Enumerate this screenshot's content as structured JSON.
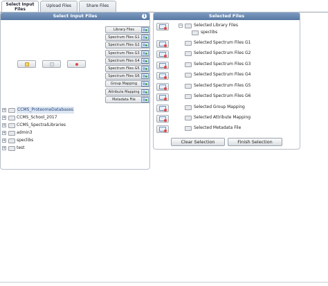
{
  "tabs": [
    {
      "label": "Select Input Files",
      "active": true
    },
    {
      "label": "Upload Files",
      "active": false
    },
    {
      "label": "Share Files",
      "active": false
    }
  ],
  "left_panel": {
    "title": "Select Input Files",
    "info_icon": "i",
    "categories": [
      "Library Files",
      "Spectrum Files G1",
      "Spectrum Files G2",
      "Spectrum Files G3",
      "Spectrum Files G4",
      "Spectrum Files G5",
      "Spectrum Files G6",
      "Group Mapping",
      "Attribute Mapping",
      "Metadata File"
    ],
    "actions": [
      "add-file-icon",
      "edit-icon",
      "delete-icon"
    ],
    "tree": [
      {
        "label": "CCMS_ProteomeDatabases",
        "selected": true
      },
      {
        "label": "CCMS_School_2017",
        "selected": false
      },
      {
        "label": "CCMS_SpectralLibraries",
        "selected": false
      },
      {
        "label": "admin3",
        "selected": false
      },
      {
        "label": "speclibs",
        "selected": false
      },
      {
        "label": "test",
        "selected": false
      }
    ]
  },
  "right_panel": {
    "title": "Selected Files",
    "items": [
      {
        "label": "Selected Library Files",
        "children": [
          "speclibs"
        ]
      },
      {
        "label": "Selected Spectrum Files G1",
        "children": []
      },
      {
        "label": "Selected Spectrum Files G2",
        "children": []
      },
      {
        "label": "Selected Spectrum Files G3",
        "children": []
      },
      {
        "label": "Selected Spectrum Files G4",
        "children": []
      },
      {
        "label": "Selected Spectrum Files G5",
        "children": []
      },
      {
        "label": "Selected Spectrum Files G6",
        "children": []
      },
      {
        "label": "Selected Group Mapping",
        "children": []
      },
      {
        "label": "Selected Attribute Mapping",
        "children": []
      },
      {
        "label": "Selected Metadata File",
        "children": []
      }
    ],
    "clear_label": "Clear Selection",
    "finish_label": "Finish Selection"
  },
  "colors": {
    "header": "#5878a4",
    "selected_row": "#dde6f3"
  }
}
